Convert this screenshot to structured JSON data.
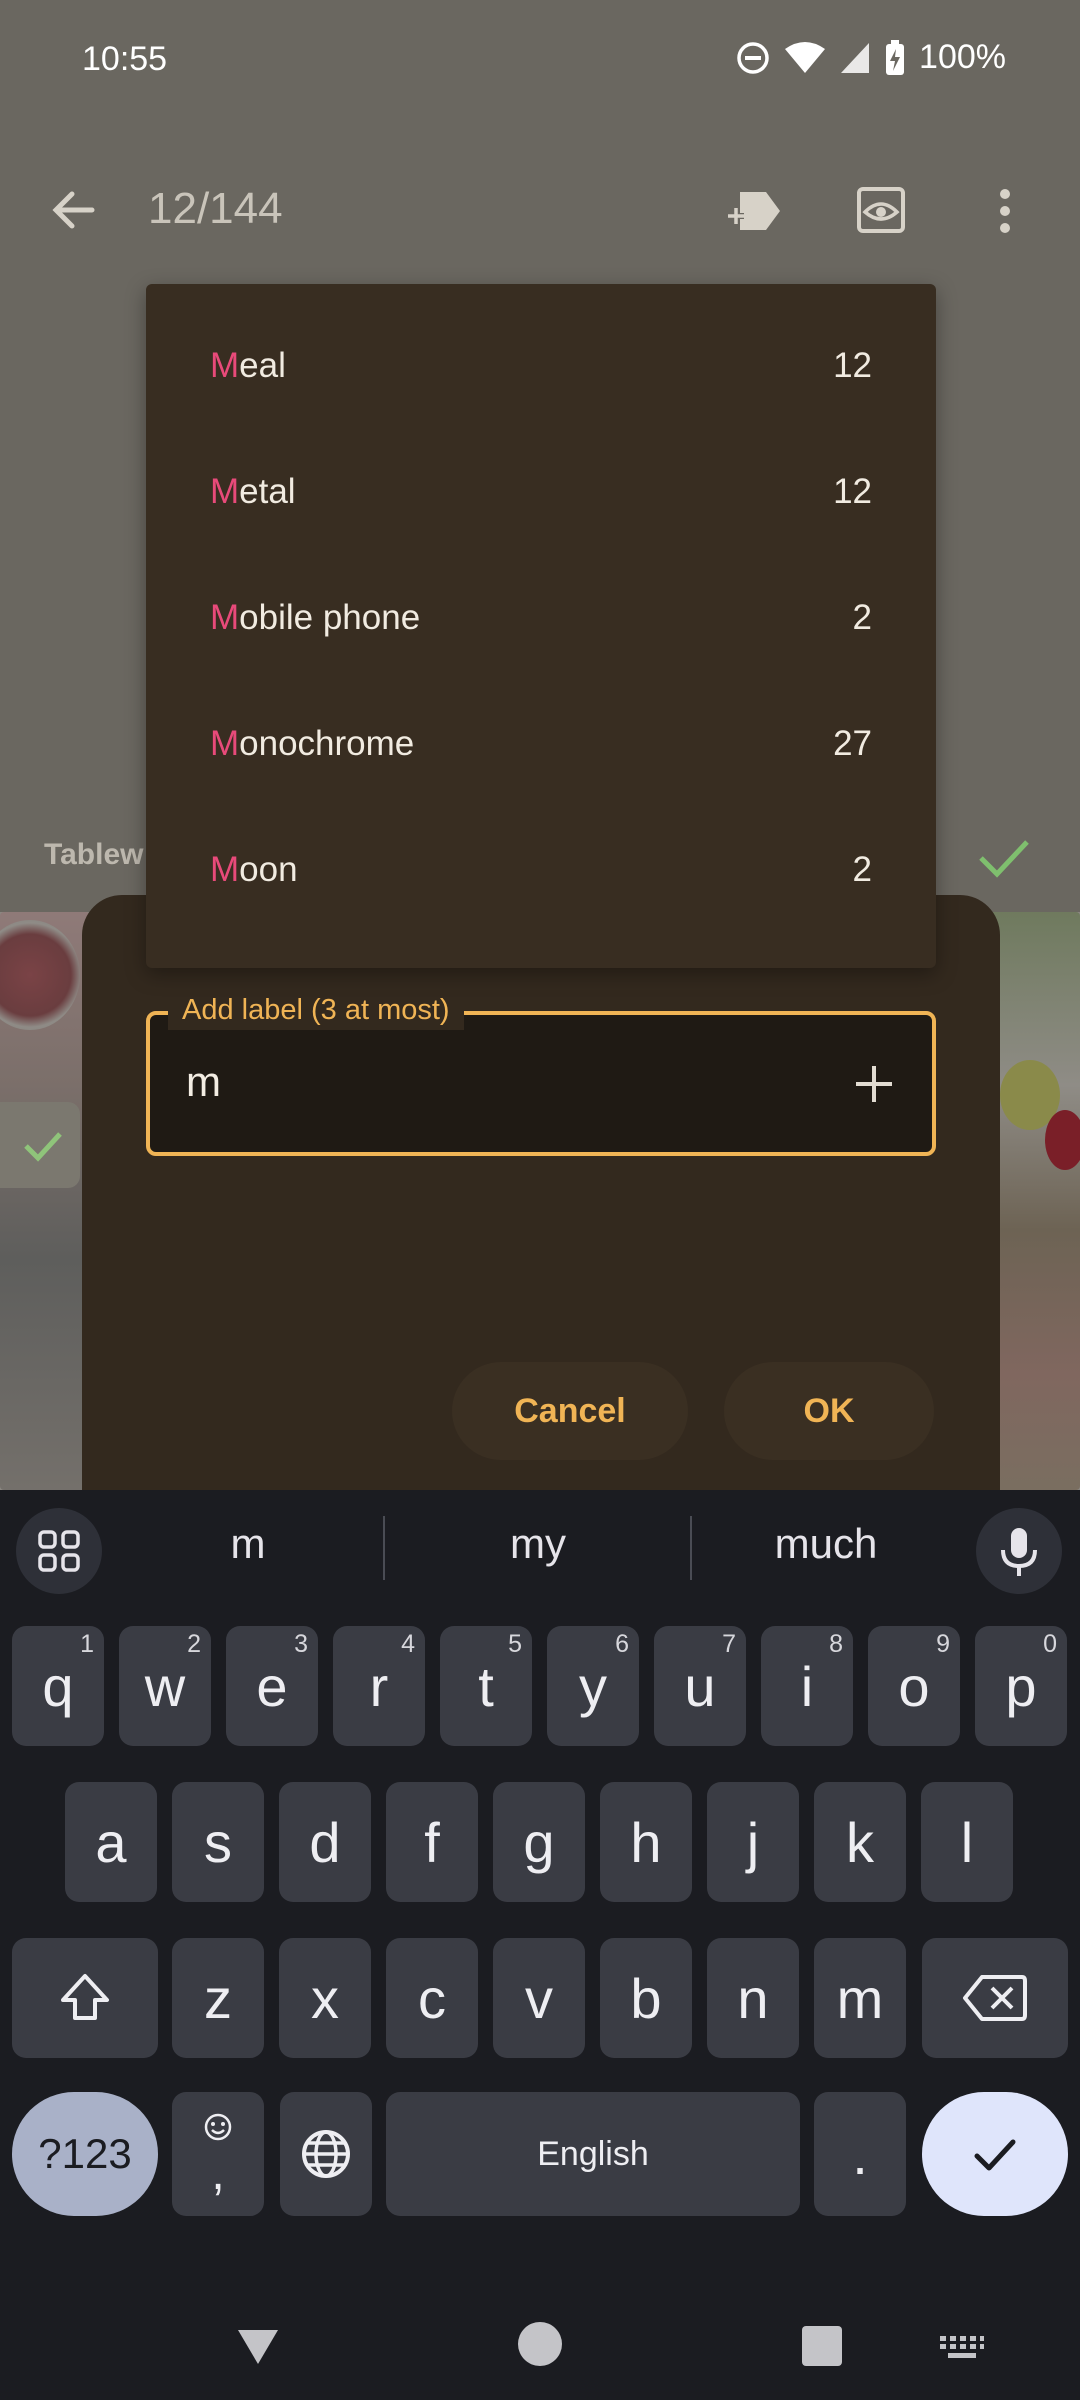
{
  "status_bar": {
    "time": "10:55",
    "battery": "100%"
  },
  "top_bar": {
    "counter": "12/144"
  },
  "background": {
    "tag_label": "Tablew"
  },
  "dropdown": {
    "items": [
      {
        "prefix": "M",
        "rest": "eal",
        "count": "12"
      },
      {
        "prefix": "M",
        "rest": "etal",
        "count": "12"
      },
      {
        "prefix": "M",
        "rest": "obile phone",
        "count": "2"
      },
      {
        "prefix": "M",
        "rest": "onochrome",
        "count": "27"
      },
      {
        "prefix": "M",
        "rest": "oon",
        "count": "2"
      }
    ]
  },
  "dialog": {
    "field_label": "Add label (3 at most)",
    "field_value": "m",
    "cancel_label": "Cancel",
    "ok_label": "OK"
  },
  "keyboard": {
    "suggestions": [
      "m",
      "my",
      "much"
    ],
    "row1": [
      {
        "key": "q",
        "sup": "1"
      },
      {
        "key": "w",
        "sup": "2"
      },
      {
        "key": "e",
        "sup": "3"
      },
      {
        "key": "r",
        "sup": "4"
      },
      {
        "key": "t",
        "sup": "5"
      },
      {
        "key": "y",
        "sup": "6"
      },
      {
        "key": "u",
        "sup": "7"
      },
      {
        "key": "i",
        "sup": "8"
      },
      {
        "key": "o",
        "sup": "9"
      },
      {
        "key": "p",
        "sup": "0"
      }
    ],
    "row2": [
      "a",
      "s",
      "d",
      "f",
      "g",
      "h",
      "j",
      "k",
      "l"
    ],
    "row3": [
      "z",
      "x",
      "c",
      "v",
      "b",
      "n",
      "m"
    ],
    "symbols_label": "?123",
    "emoji_comma": ",",
    "space_label": "English",
    "period": "."
  },
  "colors": {
    "accent": "#f0b455",
    "highlight": "#e84a7a",
    "dialog_bg": "#33291e",
    "keyboard_bg": "#1b1c21"
  }
}
